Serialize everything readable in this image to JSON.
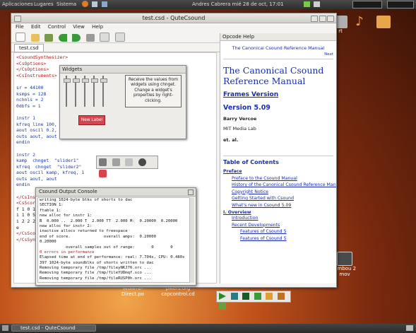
{
  "top_panel": {
    "menus": [
      "Aplicaciones",
      "Lugares",
      "Sistema"
    ],
    "right_text": "Andres Cabrera mié 28 de oct, 17:01"
  },
  "desktop": {
    "icons": [
      {
        "label": "rt"
      },
      {
        "label": "Finbuscar"
      },
      {
        "label": "Fimbou 2 mov"
      },
      {
        "label": "WGNTE-Direct.po"
      },
      {
        "label": "pikers.org capcontrol.cd"
      }
    ]
  },
  "main_window": {
    "title": "test.csd - QuteCsound",
    "menu": [
      "File",
      "Edit",
      "Control",
      "View",
      "Help"
    ],
    "tab": "test.csd",
    "code": [
      {
        "t": "<CsoundSynthesizer>",
        "c": "c-red"
      },
      {
        "t": "<CsOptions>",
        "c": "c-red"
      },
      {
        "t": "</CsOptions>",
        "c": "c-red"
      },
      {
        "t": "<CsInstruments>",
        "c": "c-red"
      },
      {
        "t": "",
        "c": "c-blk"
      },
      {
        "t": "sr = 44100",
        "c": "c-blue"
      },
      {
        "t": "ksmps = 128",
        "c": "c-blue"
      },
      {
        "t": "nchnls = 2",
        "c": "c-blue"
      },
      {
        "t": "0dbfs = 1",
        "c": "c-blue"
      },
      {
        "t": "",
        "c": "c-blk"
      },
      {
        "t": "instr 1",
        "c": "c-blue"
      },
      {
        "t": "kfreq line 100, p",
        "c": "c-blue"
      },
      {
        "t": "aout oscil 0.2, k",
        "c": "c-blue"
      },
      {
        "t": "outs aout, aout",
        "c": "c-blue"
      },
      {
        "t": "endin",
        "c": "c-blue"
      },
      {
        "t": "",
        "c": "c-blk"
      },
      {
        "t": "instr 2",
        "c": "c-blue"
      },
      {
        "t": "kamp  chnget  \"slider1\"",
        "c": "c-blue"
      },
      {
        "t": "kfreq  chnget  \"slider2\"",
        "c": "c-blue"
      },
      {
        "t": "aout oscil kamp, kfreq, 1",
        "c": "c-blue"
      },
      {
        "t": "outs aout, aout",
        "c": "c-blue"
      },
      {
        "t": "endin",
        "c": "c-blue"
      },
      {
        "t": "",
        "c": "c-blk"
      },
      {
        "t": "</CsInst",
        "c": "c-red"
      },
      {
        "t": "<CsScore",
        "c": "c-red"
      },
      {
        "t": "f 1 0 1",
        "c": "c-blk"
      },
      {
        "t": "i 1 0 5",
        "c": "c-blk"
      },
      {
        "t": "i 2 2 20",
        "c": "c-blk"
      },
      {
        "t": "e",
        "c": "c-blk"
      },
      {
        "t": "</CsScore",
        "c": "c-red"
      },
      {
        "t": "</CsSynt",
        "c": "c-red"
      }
    ]
  },
  "help": {
    "panel_title": "Opcode Help",
    "ref_link": "The Canonical Csound Reference Manual",
    "next": "Next",
    "heading": "The Canonical Csound Reference Manual",
    "frames_link": "Frames Version",
    "version": "Version 5.09",
    "author": "Barry Vercoe",
    "affil": "MIT Media Lab",
    "etal": "et. al.",
    "toc": "Table of Contents",
    "preface": "Preface",
    "preface_links": [
      "Preface to the Csound Manual",
      "History of the Canonical Csound Reference Manual",
      "Copyright Notice",
      "Getting Started with Csound",
      "What's new in Csound 5.09"
    ],
    "overview": "I. Overview",
    "overview_links": [
      "Introduction",
      "Recent Developments"
    ],
    "sub_links": [
      "Features of Csound 5",
      "Features of Csound 5"
    ]
  },
  "widgets": {
    "title": "Widgets",
    "sliders": [
      0.9,
      0.9,
      0.9,
      0.9,
      0.9
    ],
    "label": "Receive the values from widgets using chnget. Change a widget's properties by right-clicking.",
    "button": "New Label"
  },
  "console": {
    "title": "Csound Output Console",
    "lines": [
      {
        "t": "writing 1024-byte blks of shorts to dac",
        "c": "c-blk"
      },
      {
        "t": "SECTION 1:",
        "c": "c-blk"
      },
      {
        "t": "ftable 1:",
        "c": "c-blk"
      },
      {
        "t": "new alloc for instr 1:",
        "c": "c-blk"
      },
      {
        "t": "B  0.000 ..  2.000 T  2.000 TT  2.000 M:  0.20000  0.20000",
        "c": "c-blk"
      },
      {
        "t": "new alloc for instr 2:",
        "c": "c-blk"
      },
      {
        "t": "inactive allocs returned to freespace",
        "c": "c-blk"
      },
      {
        "t": "end of score.              overall amps:  0.20000",
        "c": "c-blk"
      },
      {
        "t": "0.20000",
        "c": "c-blk"
      },
      {
        "t": "           overall samples out of range:       0       0",
        "c": "c-blk"
      },
      {
        "t": "0 errors in performance",
        "c": "c-red"
      },
      {
        "t": "Elapsed time at end of performance: real: 7.704s, CPU: 0.480s",
        "c": "c-blk"
      },
      {
        "t": "397 1024-byte soundblks of shorts written to dac",
        "c": "c-blk"
      },
      {
        "t": "Removing temporary file /tmp/fileyNKJ76.orc ...",
        "c": "c-blk"
      },
      {
        "t": "Removing temporary file /tmp/fileYUDmqf.sco ...",
        "c": "c-blk"
      },
      {
        "t": "Removing temporary file /tmp/fileRUSP0h.orc ...",
        "c": "c-blk"
      }
    ]
  },
  "taskbar": {
    "item": "test.csd - QuteCsound"
  },
  "colors": {
    "accent_red": "#d9434e",
    "link": "#1a2ab0",
    "heading_blue": "#1c2ea6"
  }
}
